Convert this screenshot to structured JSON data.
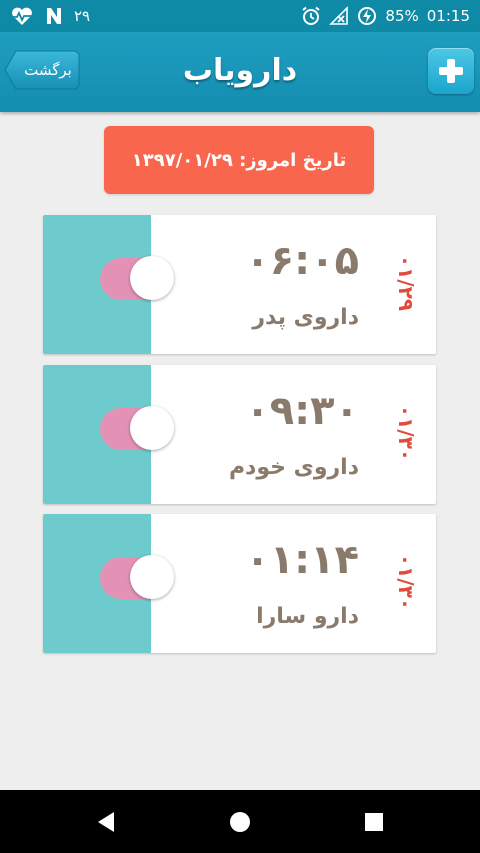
{
  "status_bar": {
    "notification_count": "۲۹",
    "battery_percent": "85%",
    "time": "01:15",
    "icons": [
      "heart-pulse-icon",
      "n-app-icon",
      "alarm-icon",
      "no-signal-icon",
      "battery-charging-icon"
    ]
  },
  "app_bar": {
    "title": "دارویاب",
    "back_label": "برگشت",
    "add_icon": "plus-icon",
    "color": "#1a98bd"
  },
  "date_banner": {
    "text": "تاریخ امروز: ۱۳۹۷/۰۱/۲۹",
    "color": "#f8674d"
  },
  "reminders": [
    {
      "time": "۰۶:۰۵",
      "name": "داروی پدر",
      "date": "۰۱/۲۹",
      "enabled": true
    },
    {
      "time": "۰۹:۳۰",
      "name": "داروی خودم",
      "date": "۰۱/۳۰",
      "enabled": true
    },
    {
      "time": "۰۱:۱۴",
      "name": "دارو سارا",
      "date": "۰۱/۳۰",
      "enabled": true
    }
  ],
  "colors": {
    "card_side": "#6ecbcd",
    "toggle_track": "#e392b6",
    "time_text": "#8a7a6c",
    "date_text": "#e24a3b"
  },
  "nav_bar": {
    "icons": [
      "back-triangle-icon",
      "home-circle-icon",
      "recents-square-icon"
    ]
  }
}
